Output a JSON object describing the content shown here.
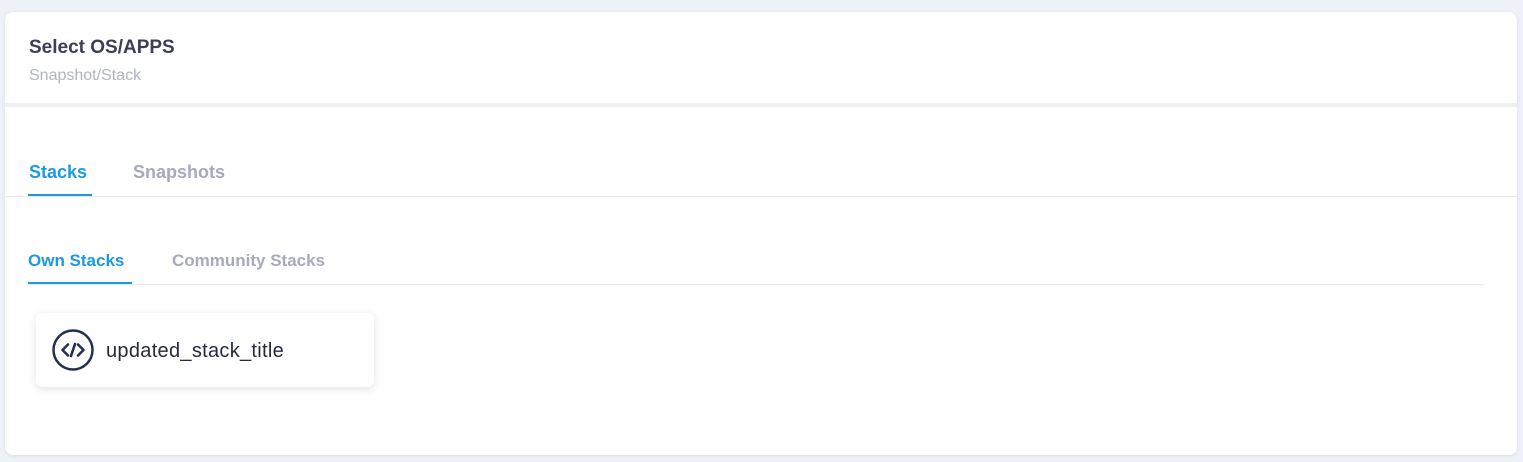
{
  "header": {
    "title": "Select OS/APPS",
    "subtitle": "Snapshot/Stack"
  },
  "main_tabs": [
    {
      "label": "Stacks",
      "active": true
    },
    {
      "label": "Snapshots",
      "active": false
    }
  ],
  "sub_tabs": [
    {
      "label": "Own Stacks",
      "active": true
    },
    {
      "label": "Community Stacks",
      "active": false
    }
  ],
  "stacks": [
    {
      "title": "updated_stack_title",
      "icon": "code-icon"
    }
  ],
  "colors": {
    "accent": "#1b9ae3",
    "title_text": "#3b3f55",
    "muted_text": "#a6aabb",
    "icon_stroke": "#24304f"
  }
}
